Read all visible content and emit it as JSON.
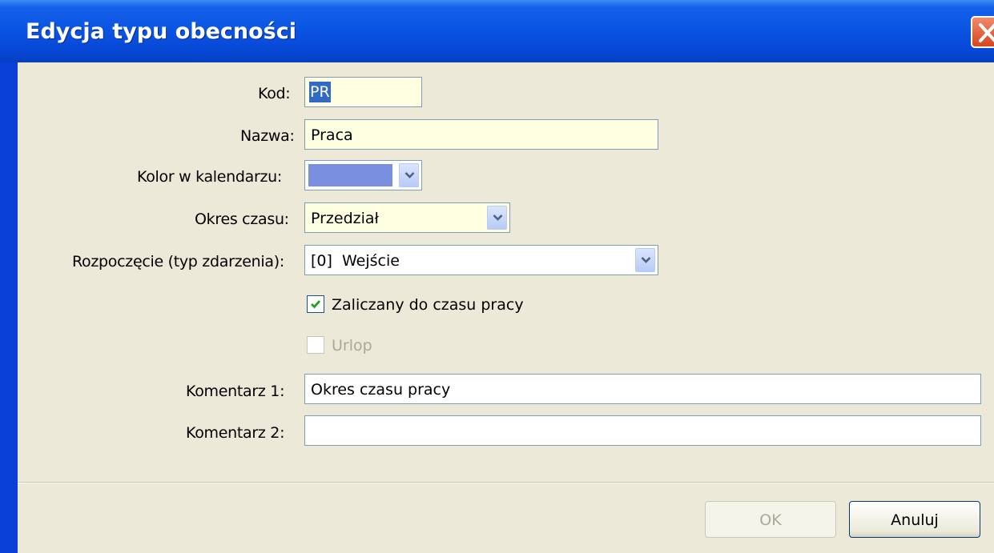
{
  "dialog": {
    "title": "Edycja typu obecności"
  },
  "form": {
    "kod_label": "Kod:",
    "kod_value": "PR",
    "nazwa_label": "Nazwa:",
    "nazwa_value": "Praca",
    "kolor_label": "Kolor w kalendarzu:",
    "kolor_value": "#7b8fe0",
    "okres_label": "Okres czasu:",
    "okres_value": "Przedział",
    "rozpoczecie_label": "Rozpoczęcie (typ zdarzenia):",
    "rozpoczecie_value": "[0]  Wejście",
    "zaliczany_label": "Zaliczany do czasu pracy",
    "zaliczany_checked": true,
    "urlop_label": "Urlop",
    "urlop_checked": false,
    "komentarz1_label": "Komentarz 1:",
    "komentarz1_value": "Okres czasu pracy",
    "komentarz2_label": "Komentarz 2:",
    "komentarz2_value": ""
  },
  "buttons": {
    "ok_label": "OK",
    "cancel_label": "Anuluj"
  },
  "icons": {
    "close": "close-icon",
    "dropdown": "chevron-down-icon",
    "check": "checkmark-icon"
  },
  "colors": {
    "titlebar": "#0b55e4",
    "client_background": "#ece9d8",
    "input_yellow": "#ffffe1",
    "selection": "#316ac5"
  }
}
